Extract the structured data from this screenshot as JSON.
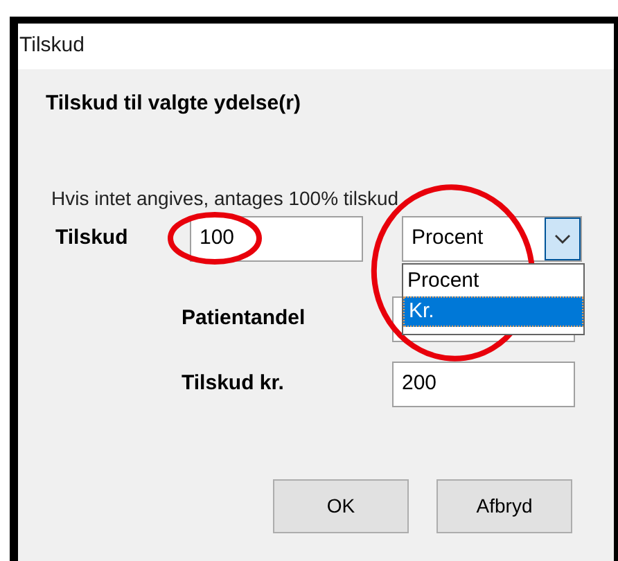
{
  "window": {
    "title": "Tilskud"
  },
  "heading": "Tilskud til valgte ydelse(r)",
  "hint": "Hvis intet angives, antages 100% tilskud",
  "fields": [
    {
      "label": "Tilskud",
      "value": "100"
    },
    {
      "label": "Patientandel"
    },
    {
      "label": "Tilskud kr.",
      "value": "200"
    }
  ],
  "unit_select": {
    "value": "Procent",
    "expanded": true,
    "options": [
      {
        "label": "Procent",
        "highlighted": false
      },
      {
        "label": "Kr.",
        "highlighted": true
      }
    ]
  },
  "buttons": [
    "OK",
    "Afbryd"
  ]
}
